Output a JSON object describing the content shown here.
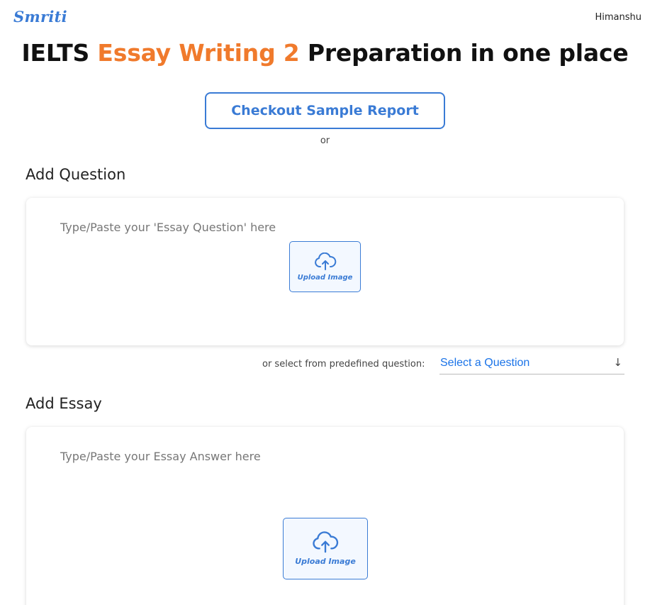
{
  "header": {
    "logo": "Smriti",
    "user_name": "Himanshu"
  },
  "title": {
    "part1": "IELTS ",
    "accent": "Essay Writing 2",
    "part2": " Preparation in one place"
  },
  "sample_report_button": "Checkout Sample Report",
  "or_text": "or",
  "question_section": {
    "heading": "Add Question",
    "placeholder": "Type/Paste your 'Essay Question' here",
    "upload_label": "Upload Image",
    "upload_icon": "cloud-upload-icon"
  },
  "predefined": {
    "label": "or select from predefined question:",
    "select_value": "Select a Question",
    "arrow": "↓",
    "arrow_icon": "arrow-down-icon"
  },
  "essay_section": {
    "heading": "Add Essay",
    "placeholder": "Type/Paste your Essay Answer here",
    "upload_label": "Upload Image",
    "upload_icon": "cloud-upload-icon"
  },
  "colors": {
    "brand_blue": "#3a7bd5",
    "accent_orange": "#f07a2c",
    "select_blue": "#1a73e8"
  }
}
